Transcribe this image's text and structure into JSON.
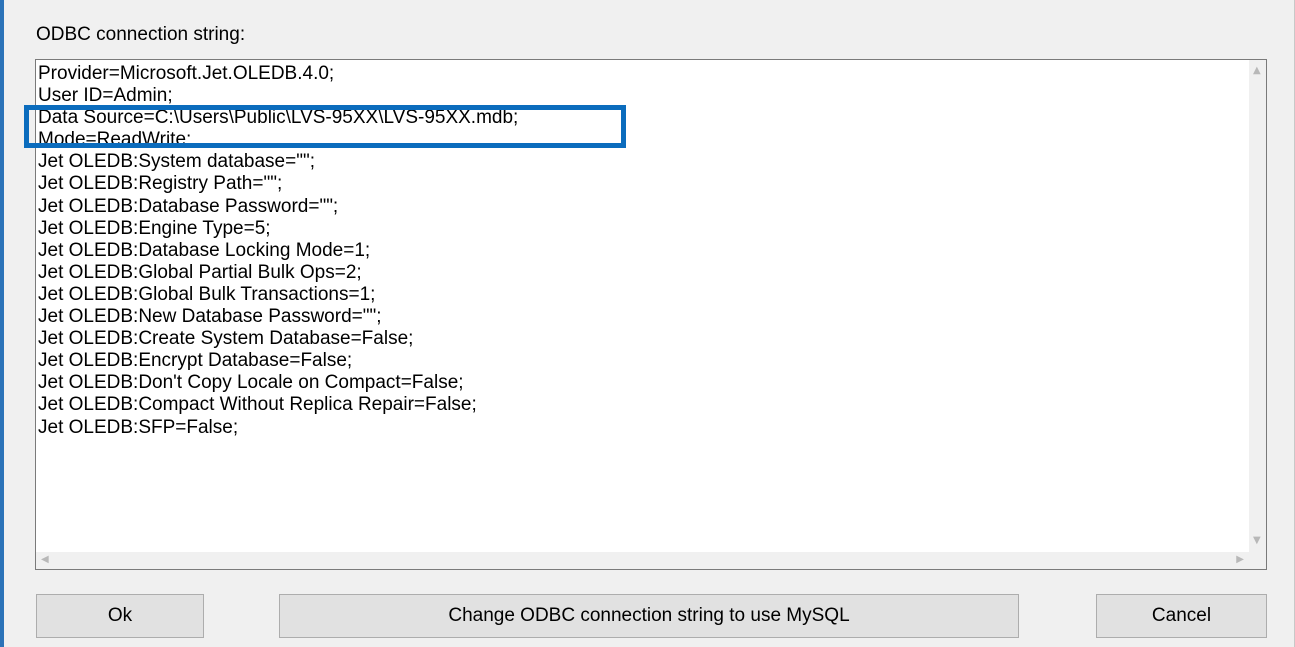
{
  "dialog": {
    "field_label": "ODBC connection string:",
    "connection_lines": [
      "Provider=Microsoft.Jet.OLEDB.4.0;",
      "User ID=Admin;",
      "Data Source=C:\\Users\\Public\\LVS-95XX\\LVS-95XX.mdb;",
      "Mode=ReadWrite;",
      "Jet OLEDB:System database=\"\";",
      "Jet OLEDB:Registry Path=\"\";",
      "Jet OLEDB:Database Password=\"\";",
      "Jet OLEDB:Engine Type=5;",
      "Jet OLEDB:Database Locking Mode=1;",
      "Jet OLEDB:Global Partial Bulk Ops=2;",
      "Jet OLEDB:Global Bulk Transactions=1;",
      "Jet OLEDB:New Database Password=\"\";",
      "Jet OLEDB:Create System Database=False;",
      "Jet OLEDB:Encrypt Database=False;",
      "Jet OLEDB:Don't Copy Locale on Compact=False;",
      "Jet OLEDB:Compact Without Replica Repair=False;",
      "Jet OLEDB:SFP=False;"
    ],
    "buttons": {
      "ok": "Ok",
      "mysql": "Change ODBC connection string to use MySQL",
      "cancel": "Cancel"
    }
  },
  "colors": {
    "highlight": "#0b6cbd",
    "window_accent": "#2b73b8"
  },
  "icons": {
    "scroll_up": "chevron-up-icon",
    "scroll_down": "chevron-down-icon",
    "scroll_left": "chevron-left-icon",
    "scroll_right": "chevron-right-icon"
  }
}
